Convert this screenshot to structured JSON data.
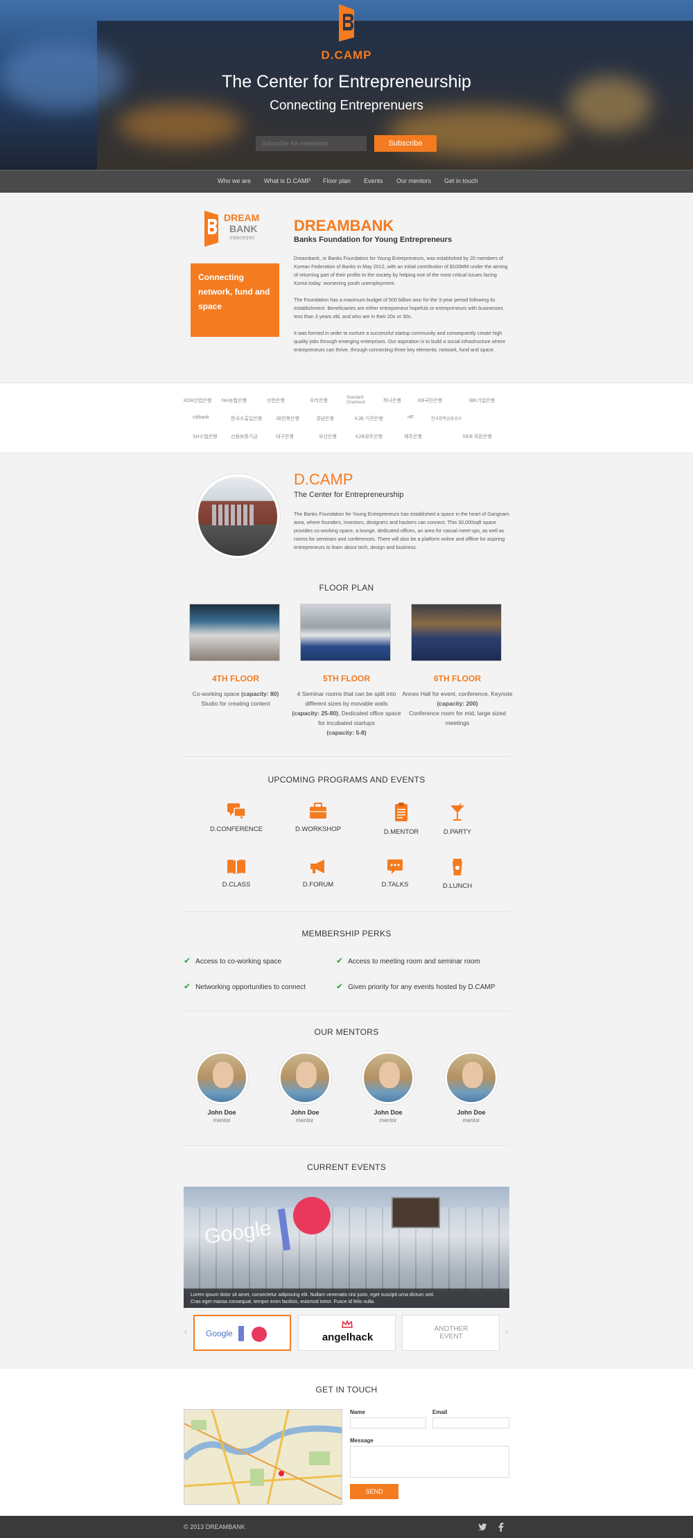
{
  "brand": {
    "name": "D.CAMP",
    "accent": "#f47b20"
  },
  "hero": {
    "title": "The Center for Entrepreneurship",
    "subtitle": "Connecting Entreprenuers",
    "subscribe_placeholder": "Subscribe for newsletter",
    "subscribe_label": "Subscribe"
  },
  "nav": {
    "items": [
      "Who we are",
      "What is D.CAMP",
      "Floor plan",
      "Events",
      "Our mentors",
      "Get in touch"
    ]
  },
  "dreambank": {
    "logo_word1": "DREAM",
    "logo_word2": "BANK",
    "logo_caption": "은행청년창업재단",
    "box_text": "Connecting network, fund and space",
    "title": "DREAMBANK",
    "subtitle": "Banks Foundation for Young Entrepreneurs",
    "p1": "Dreambank, or Banks Foundation for Young Entrepreneurs, was established by 20 members of Korean Federation of Banks in May 2012, with an initial contribution of $100MM under the aiming of returning part of their profits to the society by helping one of the most critical issues facing Korea today: worsening youth unemployment.",
    "p2": "The Foundation has a maximum budget of 500 billion won for the 3-year period following its establishment. Beneficiaries are either entrepreneur hopefuls or entrepreneurs with businesses less than 3 years old, and who are in their 20s or 30s.",
    "p3": "It was formed in order to nurture a successful startup community and consequently create high quality jobs through emerging enterprises. Our aspiration is to build a social infrastructure where entrepreneurs can thrive, through connecting three key elements: network, fund and space."
  },
  "banks": {
    "row1": [
      "KDB산업은행",
      "NH농협은행",
      "신한은행",
      "우리은행",
      "Standard Chartered",
      "하나은행",
      "KB국민은행",
      "IBK기업은행"
    ],
    "row2": [
      "citibank",
      "한국수출입은행",
      "JB전북은행",
      "경남은행",
      "KJB 기관은행",
      "HF",
      "한국정책금융공사"
    ],
    "row3": [
      "SH수협은행",
      "신용보증기금",
      "대구은행",
      "부산은행",
      "K2B광주은행",
      "제주은행",
      "KEB 외환은행"
    ]
  },
  "dcamp": {
    "title": "D.CAMP",
    "subtitle": "The Center for Entrepreneurship",
    "text": "The Banks Foundation for Young Entrepreneurs has established a space in the heart of Gangnam area, where founders, investors, designers and hackers can connect. This 30,000sqft space provides co-working space, a lounge, dedicated offices, an area for casual meet-ups, as well as rooms for seminars and conferences. There will also be a platform online and offline for aspiring entrepreneurs to learn about tech, design and business."
  },
  "floor_plan": {
    "heading": "FLOOR PLAN",
    "floors": [
      {
        "title": "4TH FLOOR",
        "line1": "Co-working space",
        "cap1": "(capacity: 80)",
        "line2": "Studio for creating content",
        "cap2": "",
        "line3": ""
      },
      {
        "title": "5TH FLOOR",
        "line1": "4 Seminar rooms that can be split into different sizes by movable walls",
        "cap1": "(capacity: 25-80)",
        "line2": ", Dedicated office space for incubated startups",
        "cap2": "(capacity: 5-8)",
        "line3": ""
      },
      {
        "title": "6TH FLOOR",
        "line1": "Annex Hall for event, conference, Keynote",
        "cap1": "(capacity: 200)",
        "line2": "Conference room for mid, large sized meetings",
        "cap2": "",
        "line3": ""
      }
    ]
  },
  "programs": {
    "heading": "UPCOMING PROGRAMS AND EVENTS",
    "items": [
      {
        "label": "D.CONFERENCE",
        "icon": "chat-bubbles-icon"
      },
      {
        "label": "D.WORKSHOP",
        "icon": "briefcase-icon"
      },
      {
        "label": "D.MENTOR",
        "icon": "clipboard-icon"
      },
      {
        "label": "D.PARTY",
        "icon": "cocktail-icon"
      },
      {
        "label": "D.CLASS",
        "icon": "book-icon"
      },
      {
        "label": "D.FORUM",
        "icon": "megaphone-icon"
      },
      {
        "label": "D.TALKS",
        "icon": "speech-bubble-icon"
      },
      {
        "label": "D.LUNCH",
        "icon": "coffee-cup-icon"
      }
    ]
  },
  "perks": {
    "heading": "MEMBERSHIP PERKS",
    "items": [
      "Access to co-working space",
      "Access to meeting room and seminar room",
      "Networking opportunities to connect",
      "Given priority for any events hosted by D.CAMP"
    ]
  },
  "mentors": {
    "heading": "OUR MENTORS",
    "items": [
      {
        "name": "John Doe",
        "role": "mentor"
      },
      {
        "name": "John Doe",
        "role": "mentor"
      },
      {
        "name": "John Doe",
        "role": "mentor"
      },
      {
        "name": "John Doe",
        "role": "mentor"
      }
    ]
  },
  "current_events": {
    "heading": "CURRENT EVENTS",
    "caption1": "Lorem ipsum dolor sit amet, consectetur adipiscing elit. Nullam venenatis nisi justo, eget suscipit urna dictum sed.",
    "caption2": "Cras eget massa consequat, tempor enim facilisis, euismod tortor. Fusce id felis nulla.",
    "banner_text": "Google",
    "thumbs": [
      "Google",
      "angelhack",
      "ANOTHER EVENT"
    ]
  },
  "contact": {
    "heading": "GET IN TOUCH",
    "name_label": "Name",
    "email_label": "Email",
    "message_label": "Message",
    "send_label": "SEND"
  },
  "footer": {
    "copyright": "© 2013 DREAMBANK"
  }
}
